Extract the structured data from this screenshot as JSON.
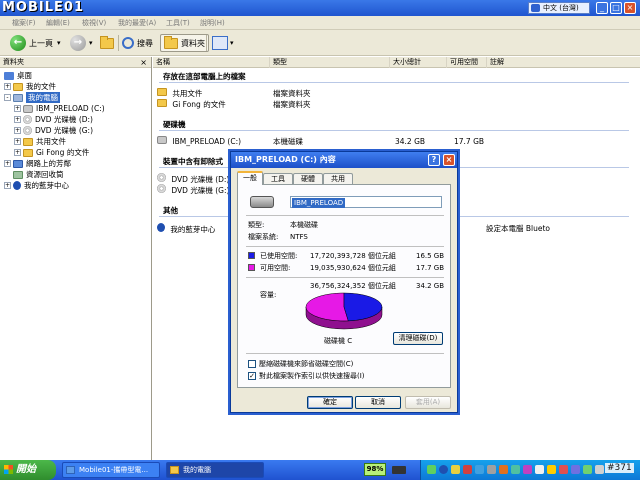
{
  "window": {
    "logo_text": "MOBILE01",
    "language": "中文 (台灣)",
    "btn_min": "_",
    "btn_max": "□",
    "btn_close": "×"
  },
  "menu": [
    "檔案(F)",
    "編輯(E)",
    "檢視(V)",
    "我的最愛(A)",
    "工具(T)",
    "說明(H)"
  ],
  "toolbar": {
    "back_label": "上一頁",
    "search_label": "搜尋",
    "folders_label": "資料夾",
    "dropdown_arrow": "▾"
  },
  "tree": {
    "header": "資料夾",
    "close": "×",
    "items": [
      {
        "label": "桌面",
        "icon": "desktop-icon",
        "expander": ""
      },
      {
        "label": "我的文件",
        "icon": "folder-icon",
        "expander": "+"
      },
      {
        "label": "我的電腦",
        "icon": "computer-icon",
        "expander": "-"
      },
      {
        "label": "IBM_PRELOAD (C:)",
        "icon": "drive-icon",
        "expander": "+"
      },
      {
        "label": "DVD 光碟機 (D:)",
        "icon": "cd-icon",
        "expander": "+"
      },
      {
        "label": "DVD 光碟機 (G:)",
        "icon": "cd-icon",
        "expander": "+"
      },
      {
        "label": "共用文件",
        "icon": "folder-icon",
        "expander": "+"
      },
      {
        "label": "Gi Fong 的文件",
        "icon": "folder-icon",
        "expander": "+"
      },
      {
        "label": "網路上的芳鄰",
        "icon": "network-icon",
        "expander": "+"
      },
      {
        "label": "資源回收筒",
        "icon": "recycle-bin-icon",
        "expander": ""
      },
      {
        "label": "我的藍芽中心",
        "icon": "bluetooth-icon",
        "expander": "+"
      }
    ]
  },
  "columns": [
    "名稱",
    "類型",
    "大小總計",
    "可用空間",
    "註解"
  ],
  "groups": {
    "stored": "存放在這部電腦上的檔案",
    "hdd": "硬碟機",
    "removable": "裝置中含有卸除式",
    "other": "其他"
  },
  "rows": {
    "shared_docs": {
      "name": "共用文件",
      "type": "檔案資料夾"
    },
    "gifong_docs": {
      "name": "Gi Fong 的文件",
      "type": "檔案資料夾"
    },
    "drive_c": {
      "name": "IBM_PRELOAD (C:)",
      "type": "本機磁碟",
      "size": "34.2 GB",
      "free": "17.7 GB"
    },
    "dvd_d": {
      "name": "DVD 光碟機 (D:)"
    },
    "dvd_g": {
      "name": "DVD 光碟機 (G:)"
    },
    "bt_center": {
      "name": "我的藍芽中心",
      "comment": "設定本電腦 Blueto"
    }
  },
  "dialog": {
    "title": "IBM_PRELOAD (C:) 內容",
    "help": "?",
    "close": "×",
    "tabs": [
      "一般",
      "工具",
      "硬體",
      "共用"
    ],
    "name_value": "IBM_PRELOAD",
    "type_label": "類型:",
    "type_value": "本機磁碟",
    "fs_label": "檔案系統:",
    "fs_value": "NTFS",
    "used_label": "已使用空間:",
    "used_bytes": "17,720,393,728 個位元組",
    "used_size": "16.5 GB",
    "free_label": "可用空間:",
    "free_bytes": "19,035,930,624 個位元組",
    "free_size": "17.7 GB",
    "cap_label": "容量:",
    "cap_bytes": "36,756,324,352 個位元組",
    "cap_size": "34.2 GB",
    "drive_label": "磁碟機 C",
    "cleanup_btn": "清理磁碟(D)",
    "compress_label": "壓縮磁碟機來節省磁碟空間(C)",
    "index_label": "對此檔案製作索引以供快速搜尋(I)",
    "compress_checked": false,
    "index_checked": true,
    "ok": "確定",
    "cancel": "取消",
    "apply": "套用(A)",
    "used_color": "#1a1ae6",
    "free_color": "#e619e6"
  },
  "taskbar": {
    "start": "開始",
    "task1": "Mobile01-攜帶型電...",
    "task2": "我的電腦",
    "battery": "98%"
  },
  "post_tag": "#371"
}
